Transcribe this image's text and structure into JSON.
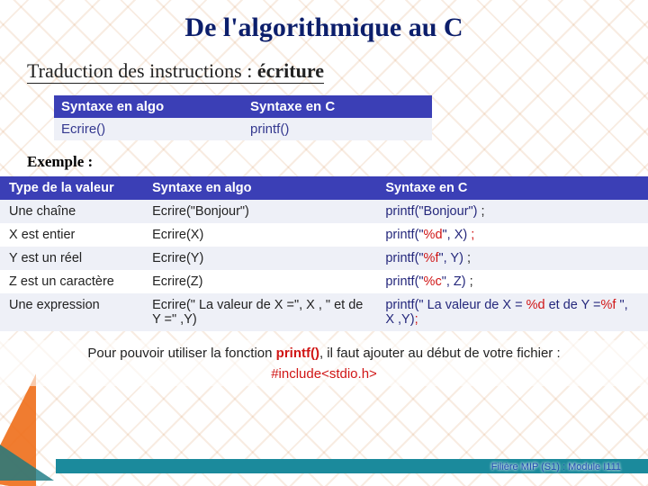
{
  "title": "De l'algorithmique au C",
  "subtitle_prefix": "Traduction des instructions : ",
  "subtitle_bold": "écriture",
  "table1": {
    "h1": "Syntaxe en algo",
    "h2": "Syntaxe  en C",
    "c1": "Ecrire()",
    "c2": "printf()"
  },
  "exemple_label": "Exemple :",
  "table2": {
    "h1": "Type de la valeur",
    "h2": "Syntaxe en algo",
    "h3": "Syntaxe en C",
    "rows": [
      {
        "type": "Une chaîne",
        "algo": "Ecrire(\"Bonjour\")",
        "c_pre": "printf(\"Bonjour\")",
        "c_fmt": "",
        "c_post": "",
        "c_tail": " ;"
      },
      {
        "type": "X est entier",
        "algo": "Ecrire(X)",
        "c_pre": "printf(\"",
        "c_fmt": "%d",
        "c_post": "\", X)",
        "c_tail": " ;"
      },
      {
        "type": "Y est un réel",
        "algo": "Ecrire(Y)",
        "c_pre": "printf(\"",
        "c_fmt": "%f",
        "c_post": "\", Y)",
        "c_tail": " ;"
      },
      {
        "type": "Z est un caractère",
        "algo": "Ecrire(Z)",
        "c_pre": "printf(\"",
        "c_fmt": "%c",
        "c_post": "\", Z)",
        "c_tail": " ;"
      },
      {
        "type": "Une expression",
        "algo": "Ecrire(\" La valeur de X =\", X , \" et de Y =\" ,Y)",
        "c_pre": "printf(\" La valeur de X = ",
        "c_fmt": "%d",
        "c_mid": " et de Y =",
        "c_fmt2": "%f",
        "c_post2": " \", X ,Y)",
        "c_tail": ";"
      }
    ]
  },
  "note": {
    "l1_a": "Pour pouvoir utiliser la fonction ",
    "l1_b": "printf()",
    "l1_c": ", il faut ajouter au début de votre fichier :",
    "l2": "#include<stdio.h>"
  },
  "footer": "Filière MIP (S1) : Module I111"
}
